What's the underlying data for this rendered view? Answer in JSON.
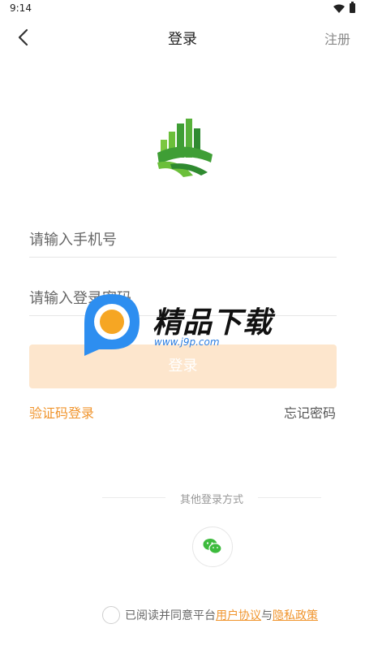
{
  "status_bar": {
    "time": "9:14"
  },
  "header": {
    "title": "登录",
    "register_label": "注册"
  },
  "form": {
    "phone_placeholder": "请输入手机号",
    "password_placeholder": "请输入登录密码",
    "login_label": "登录"
  },
  "links": {
    "sms_login": "验证码登录",
    "forgot_password": "忘记密码"
  },
  "other_login": {
    "label": "其他登录方式"
  },
  "agreement": {
    "prefix": "已阅读并同意平台",
    "user_agreement": "用户协议",
    "conjunction": "与",
    "privacy_policy": "隐私政策"
  },
  "watermark": {
    "title": "精品下载",
    "url": "www.j9p.com"
  },
  "colors": {
    "accent": "#f0942c",
    "button_bg": "#fde6cd",
    "logo_green": "#4caf50"
  }
}
